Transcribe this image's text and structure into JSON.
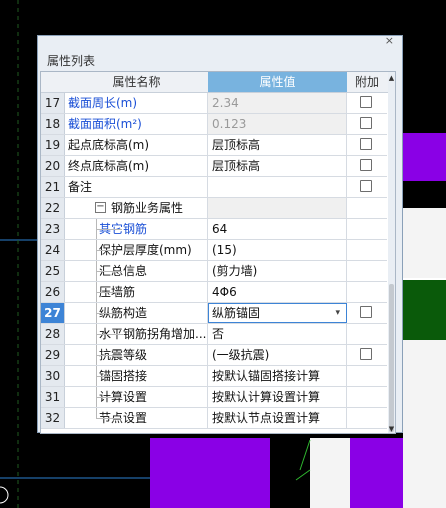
{
  "panel": {
    "title": "属性列表",
    "close_glyph": "×",
    "columns": {
      "name": "属性名称",
      "value": "属性值",
      "attach": "附加"
    },
    "rows": [
      {
        "num": "17",
        "name": "截面周长(m)",
        "value": "2.34",
        "style": "blue",
        "value_style": "gray",
        "checkbox": true
      },
      {
        "num": "18",
        "name": "截面面积(m²)",
        "value": "0.123",
        "style": "blue",
        "value_style": "gray",
        "checkbox": true
      },
      {
        "num": "19",
        "name": "起点底标高(m)",
        "value": "层顶标高",
        "style": "",
        "value_style": "",
        "checkbox": true
      },
      {
        "num": "20",
        "name": "终点底标高(m)",
        "value": "层顶标高",
        "style": "",
        "value_style": "",
        "checkbox": true
      },
      {
        "num": "21",
        "name": "备注",
        "value": "",
        "style": "",
        "value_style": "",
        "checkbox": true
      },
      {
        "num": "22",
        "name": "钢筋业务属性",
        "value": "",
        "style": "group",
        "value_style": "group",
        "checkbox": false
      },
      {
        "num": "23",
        "name": "其它钢筋",
        "value": "64",
        "style": "blue-indent",
        "value_style": "",
        "checkbox": false
      },
      {
        "num": "24",
        "name": "保护层厚度(mm)",
        "value": "(15)",
        "style": "indent",
        "value_style": "",
        "checkbox": false
      },
      {
        "num": "25",
        "name": "汇总信息",
        "value": "(剪力墙)",
        "style": "indent",
        "value_style": "",
        "checkbox": false
      },
      {
        "num": "26",
        "name": "压墙筋",
        "value": "4Φ6",
        "style": "indent",
        "value_style": "",
        "checkbox": false
      },
      {
        "num": "27",
        "name": "纵筋构造",
        "value": "纵筋锚固",
        "style": "indent",
        "value_style": "dropdown",
        "checkbox": true,
        "selected": true
      },
      {
        "num": "28",
        "name": "水平钢筋拐角增加...",
        "value": "否",
        "style": "indent",
        "value_style": "",
        "checkbox": false
      },
      {
        "num": "29",
        "name": "抗震等级",
        "value": "(一级抗震)",
        "style": "indent",
        "value_style": "",
        "checkbox": true
      },
      {
        "num": "30",
        "name": "锚固搭接",
        "value": "按默认锚固搭接计算",
        "style": "indent",
        "value_style": "",
        "checkbox": false
      },
      {
        "num": "31",
        "name": "计算设置",
        "value": "按默认计算设置计算",
        "style": "indent",
        "value_style": "",
        "checkbox": false
      },
      {
        "num": "32",
        "name": "节点设置",
        "value": "按默认节点设置计算",
        "style": "indent",
        "value_style": "",
        "checkbox": false
      }
    ],
    "expander_glyph": "−",
    "dropdown_glyph": "▾",
    "scroll_up_glyph": "▲",
    "scroll_down_glyph": "▼"
  },
  "colors": {
    "accent_header": "#78b3df",
    "selected_row": "#3d84d6",
    "link_text": "#1a4fd6",
    "cad_magenta": "#8a00e6",
    "cad_green": "#0a5a0a"
  }
}
